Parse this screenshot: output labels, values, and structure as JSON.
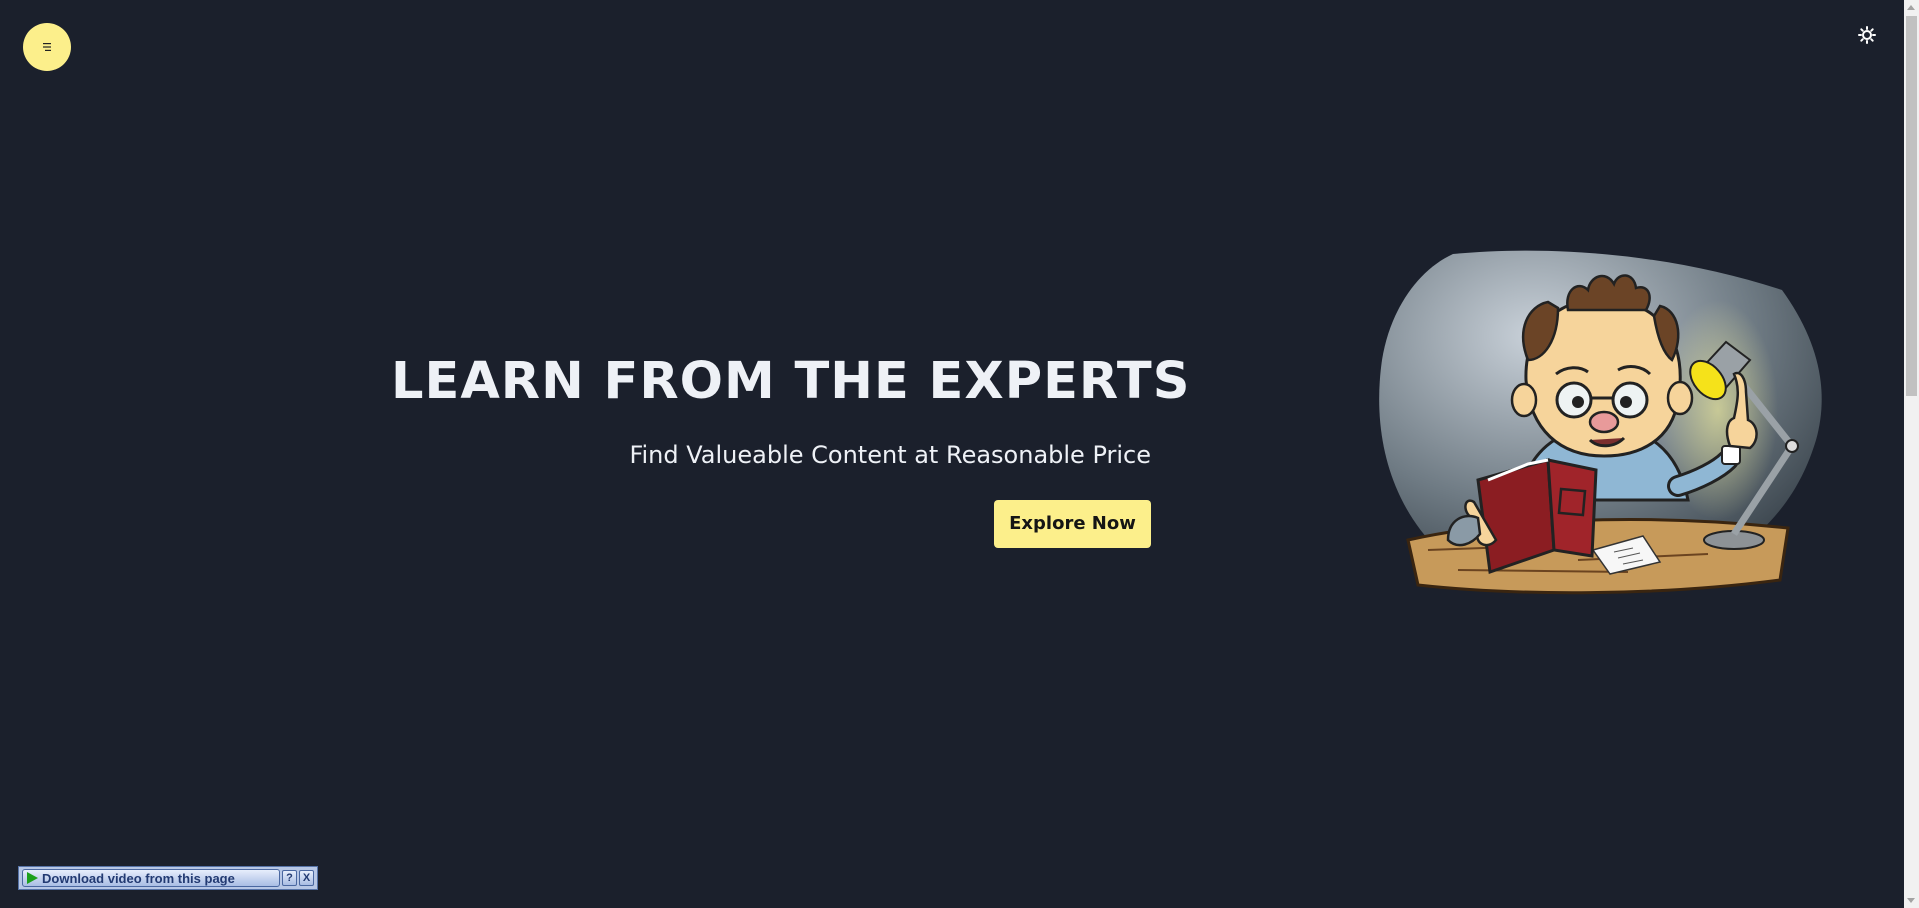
{
  "header": {
    "menu_icon": "menu-lines-icon",
    "theme_icon": "sun-icon",
    "menu_color": "#fcef8b"
  },
  "hero": {
    "title": "LEARN FROM THE EXPERTS",
    "subtitle": "Find Valueable Content at Reasonable Price",
    "cta_label": "Explore Now"
  },
  "illustration": {
    "description_icon": "professor-reading-illustration"
  },
  "download_bar": {
    "label": "Download video from this page",
    "help_label": "?",
    "close_label": "X"
  },
  "colors": {
    "background": "#1b202c",
    "accent": "#fcef8b",
    "text": "#eef1f6"
  }
}
